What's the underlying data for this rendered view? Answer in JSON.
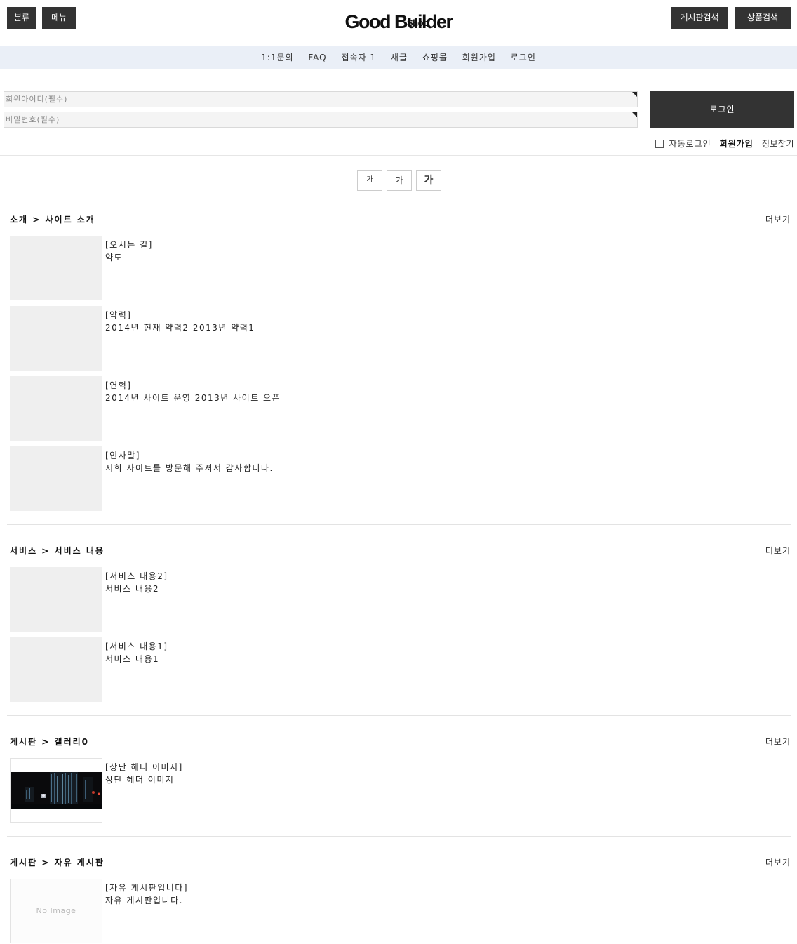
{
  "header": {
    "btn_category": "분류",
    "btn_menu": "메뉴",
    "logo_main": "Good Builder",
    "logo_sub": "Shop",
    "btn_board_search": "게시판검색",
    "btn_product_search": "상품검색"
  },
  "nav": {
    "items": [
      "1:1문의",
      "FAQ",
      "접속자 1",
      "새글",
      "쇼핑몰",
      "회원가입",
      "로그인"
    ]
  },
  "login": {
    "id_placeholder": "회원아이디(필수)",
    "pw_placeholder": "비밀번호(필수)",
    "login_button": "로그인",
    "auto_login": "자동로그인",
    "join": "회원가입",
    "find": "정보찾기"
  },
  "font_size": [
    "가",
    "가",
    "가"
  ],
  "sections": [
    {
      "title": "소개 > 사이트 소개",
      "more": "더보기",
      "items": [
        {
          "title": "[오시는 길]",
          "desc": "약도"
        },
        {
          "title": "[약력]",
          "desc": "2014년-현재 약력2 2013년 약력1"
        },
        {
          "title": "[연혁]",
          "desc": "2014년 사이트 운영 2013년 사이트 오픈"
        },
        {
          "title": "[인사말]",
          "desc": "저희 사이트를 방문해 주셔서 감사합니다."
        }
      ]
    },
    {
      "title": "서비스 > 서비스 내용",
      "more": "더보기",
      "items": [
        {
          "title": "[서비스 내용2]",
          "desc": "서비스 내용2"
        },
        {
          "title": "[서비스 내용1]",
          "desc": "서비스 내용1"
        }
      ]
    },
    {
      "title": "게시판 > 갤러리0",
      "more": "더보기",
      "items": [
        {
          "title": "[상단 헤더 이미지]",
          "desc": "상단 헤더 이미지"
        }
      ]
    },
    {
      "title": "게시판 > 자유 게시판",
      "more": "더보기",
      "items": [
        {
          "title": "[자유 게시판입니다]",
          "desc": "자유 게시판입니다.",
          "thumb_text": "No Image"
        }
      ]
    }
  ]
}
